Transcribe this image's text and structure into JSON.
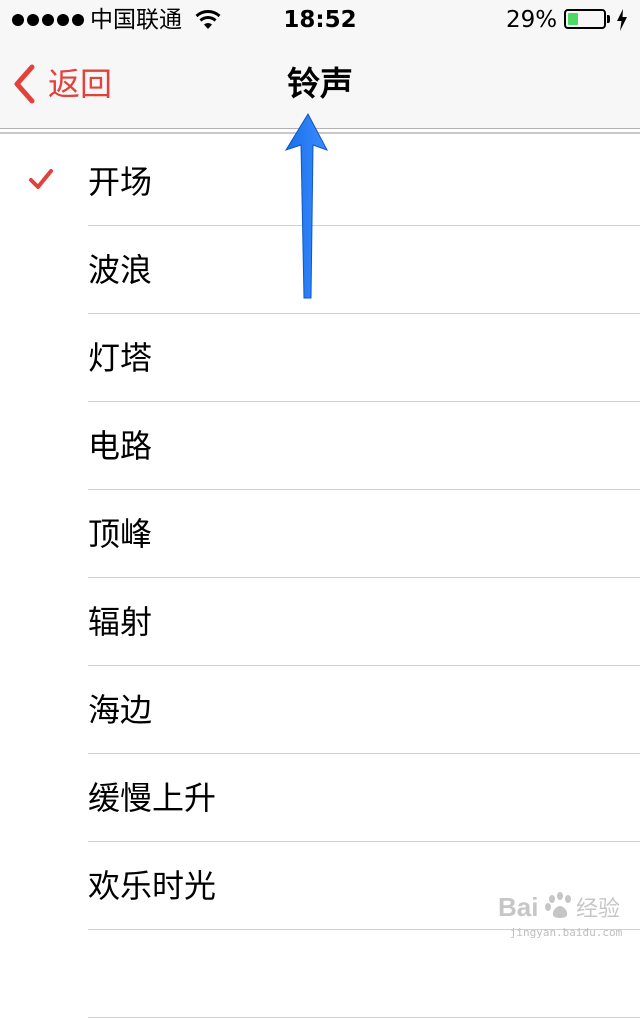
{
  "status_bar": {
    "carrier": "中国联通",
    "time": "18:52",
    "battery_percent": "29%",
    "battery_level": 0.29,
    "battery_color": "#4cd964"
  },
  "nav": {
    "back_label": "返回",
    "title": "铃声",
    "accent_color": "#e3413b"
  },
  "ringtones": [
    {
      "label": "开场",
      "selected": true
    },
    {
      "label": "波浪",
      "selected": false
    },
    {
      "label": "灯塔",
      "selected": false
    },
    {
      "label": "电路",
      "selected": false
    },
    {
      "label": "顶峰",
      "selected": false
    },
    {
      "label": "辐射",
      "selected": false
    },
    {
      "label": "海边",
      "selected": false
    },
    {
      "label": "缓慢上升",
      "selected": false
    },
    {
      "label": "欢乐时光",
      "selected": false
    },
    {
      "label": "",
      "selected": false
    }
  ],
  "icons": {
    "signal": "signal-dots-icon",
    "wifi": "wifi-icon",
    "battery": "battery-icon",
    "charging": "charging-bolt-icon",
    "back": "chevron-left-icon",
    "check": "checkmark-icon",
    "annotation": "up-arrow-icon"
  },
  "watermark": {
    "text": "jingyan.baidu.com"
  }
}
